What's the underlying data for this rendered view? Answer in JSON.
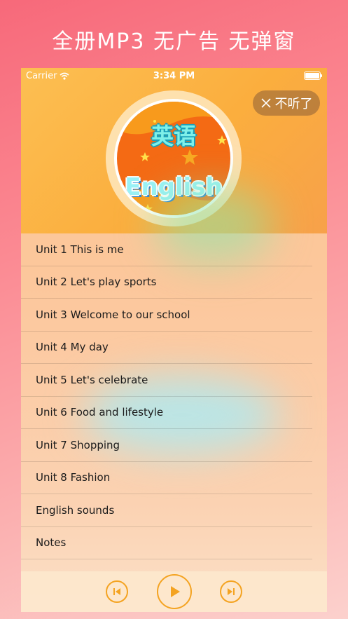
{
  "promo": {
    "title": "全册MP3 无广告 无弹窗"
  },
  "status": {
    "carrier": "Carrier",
    "time": "3:34 PM"
  },
  "header": {
    "close_label": "不听了",
    "cover": {
      "cn_title": "英语",
      "en_title": "English"
    }
  },
  "units": [
    {
      "label": "Unit 1 This is me"
    },
    {
      "label": "Unit 2 Let's play sports"
    },
    {
      "label": "Unit 3 Welcome to our school"
    },
    {
      "label": "Unit 4 My day"
    },
    {
      "label": "Unit 5 Let's celebrate"
    },
    {
      "label": "Unit 6 Food and lifestyle"
    },
    {
      "label": "Unit 7 Shopping"
    },
    {
      "label": "Unit 8 Fashion"
    },
    {
      "label": "English sounds"
    },
    {
      "label": "Notes"
    }
  ],
  "player": {
    "icons": [
      "previous-icon",
      "play-icon",
      "next-icon"
    ]
  },
  "colors": {
    "accent": "#f4a321",
    "header": "#fbae3e",
    "cover": "#f46a14"
  }
}
